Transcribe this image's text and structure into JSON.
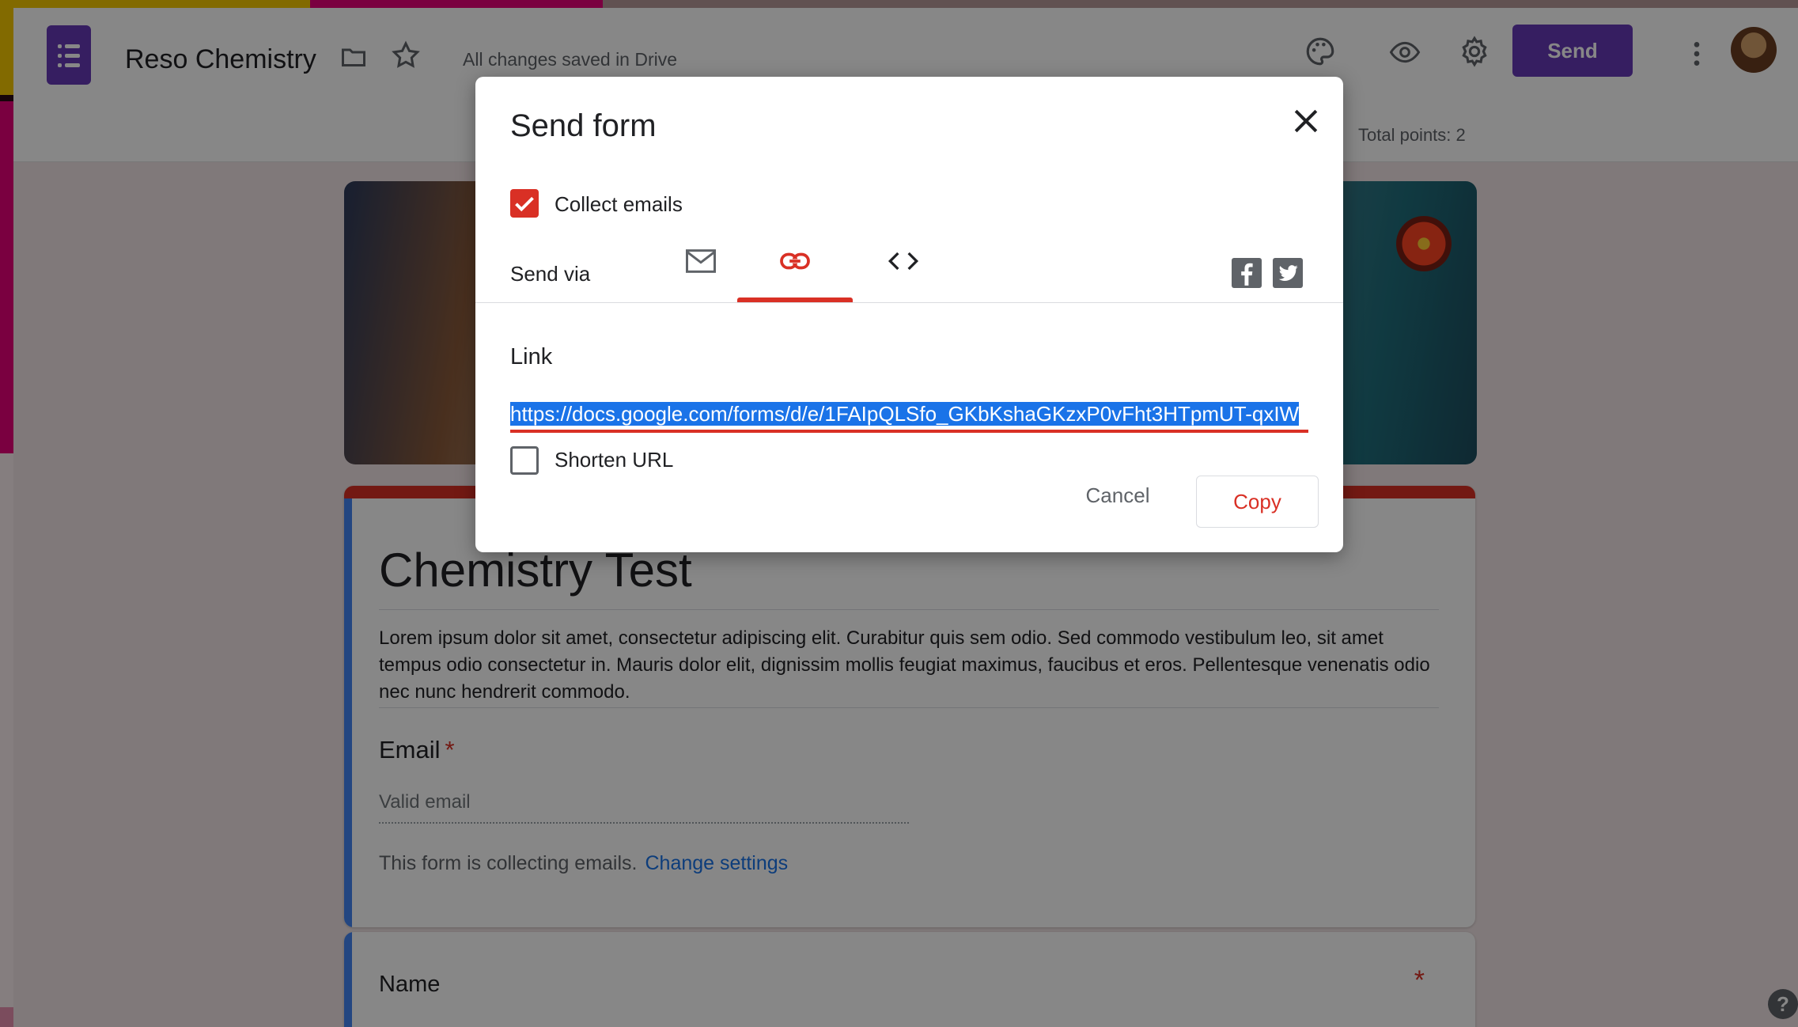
{
  "app": {
    "title": "Reso Chemistry",
    "saved_status": "All changes saved in Drive",
    "send_label": "Send",
    "total_points": "Total points: 2"
  },
  "form": {
    "title": "Chemistry Test",
    "description": "Lorem ipsum dolor sit amet, consectetur adipiscing elit. Curabitur quis sem odio. Sed commodo vestibulum leo, sit amet tempus odio consectetur in. Mauris dolor elit, dignissim mollis feugiat maximus, faucibus et eros. Pellentesque venenatis odio nec nunc hendrerit commodo.",
    "email_label": "Email",
    "required_mark": "*",
    "email_placeholder": "Valid email",
    "collecting_text": "This form is collecting emails.",
    "change_settings": "Change settings",
    "name_label": "Name",
    "help_glyph": "?"
  },
  "dialog": {
    "title": "Send form",
    "collect_emails_label": "Collect emails",
    "collect_emails_checked": true,
    "send_via_label": "Send via",
    "tabs": [
      "email-icon",
      "link-icon",
      "embed-icon"
    ],
    "active_tab": "link-icon",
    "social": [
      "facebook-icon",
      "twitter-icon"
    ],
    "link_label": "Link",
    "url": "https://docs.google.com/forms/d/e/1FAIpQLSfo_GKbKshaGKzxP0vFht3HTpmUT-qxIW",
    "shorten_url_label": "Shorten URL",
    "shorten_url_checked": false,
    "cancel_label": "Cancel",
    "copy_label": "Copy"
  },
  "colors": {
    "accent": "#673ab7",
    "red": "#d93025",
    "link_blue": "#1a73e8",
    "selection": "#1a73e8"
  }
}
